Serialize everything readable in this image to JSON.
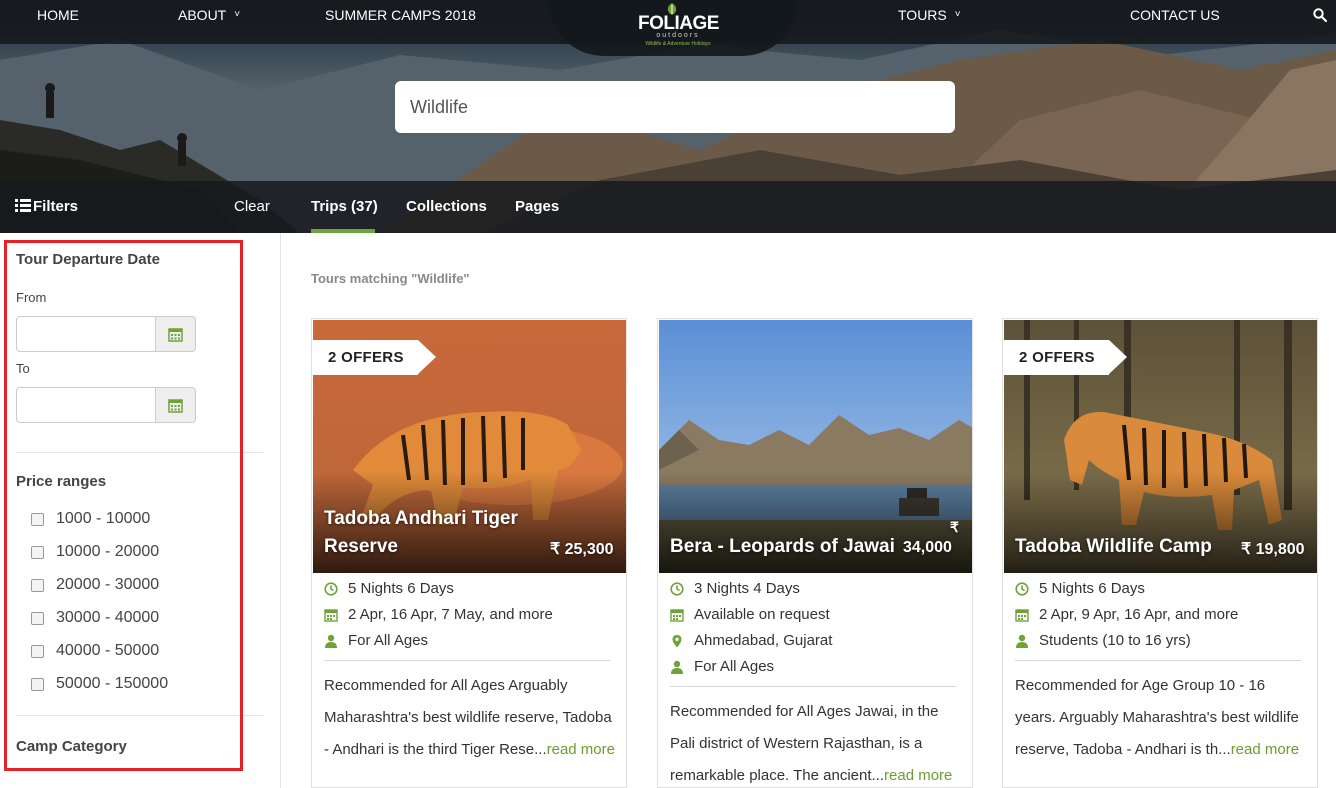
{
  "nav": {
    "home": "HOME",
    "about": "ABOUT",
    "summer_camps": "SUMMER CAMPS 2018",
    "tours": "TOURS",
    "contact": "CONTACT US",
    "chevron": "˅"
  },
  "logo": {
    "name": "FOLIAGE",
    "sub": "outdoors",
    "tagline": "Wildlife & Adventure Holidays"
  },
  "search": {
    "value": "Wildlife"
  },
  "filter_bar": {
    "filters_label": "Filters",
    "clear_label": "Clear",
    "tabs": [
      "Trips (37)",
      "Collections",
      "Pages"
    ],
    "active_tab": 0
  },
  "sidebar": {
    "departure_heading": "Tour Departure Date",
    "from_label": "From",
    "to_label": "To",
    "price_heading": "Price ranges",
    "price_ranges": [
      "1000 - 10000",
      "10000 - 20000",
      "20000 - 30000",
      "30000 - 40000",
      "40000 - 50000",
      "50000 - 150000"
    ],
    "camp_heading": "Camp Category"
  },
  "results": {
    "title": "Tours matching \"Wildlife\"",
    "cards": [
      {
        "badge": "2 OFFERS",
        "name_line1": "Tadoba Andhari Tiger",
        "name_line2": "Reserve",
        "price": "₹ 25,300",
        "duration": "5 Nights 6 Days",
        "dates": "2 Apr, 16 Apr, 7 May, and more",
        "ages": "For All Ages",
        "desc_lines": [
          "Recommended for All Ages Arguably",
          "Maharashtra's best wildlife reserve, Tadoba",
          "- Andhari is the third Tiger Rese..."
        ],
        "read_more": "read more"
      },
      {
        "name_line1": "Bera - Leopards of Jawai",
        "price_symbol": "₹",
        "price": "34,000",
        "duration": "3 Nights 4 Days",
        "dates": "Available on request",
        "location": "Ahmedabad, Gujarat",
        "ages": "For All Ages",
        "desc_lines": [
          "Recommended for All Ages Jawai, in the",
          "Pali district of Western Rajasthan, is a",
          "remarkable place. The ancient..."
        ],
        "read_more": "read more"
      },
      {
        "badge": "2 OFFERS",
        "name_line1": "Tadoba Wildlife Camp",
        "price": "₹ 19,800",
        "duration": "5 Nights 6 Days",
        "dates": "2 Apr, 9 Apr, 16 Apr, and more",
        "ages": "Students (10 to 16 yrs)",
        "desc_lines": [
          "Recommended for Age Group 10 - 16",
          "years. Arguably Maharashtra's best wildlife",
          "reserve, Tadoba - Andhari is th..."
        ],
        "read_more": "read more"
      }
    ]
  },
  "colors": {
    "accent_green": "#6fa33a",
    "annotation_red": "#e5212a",
    "nav_dark": "#14181c"
  },
  "icons": [
    "search-icon",
    "list-icon",
    "calendar-icon",
    "clock-icon",
    "user-icon",
    "map-pin-icon"
  ]
}
